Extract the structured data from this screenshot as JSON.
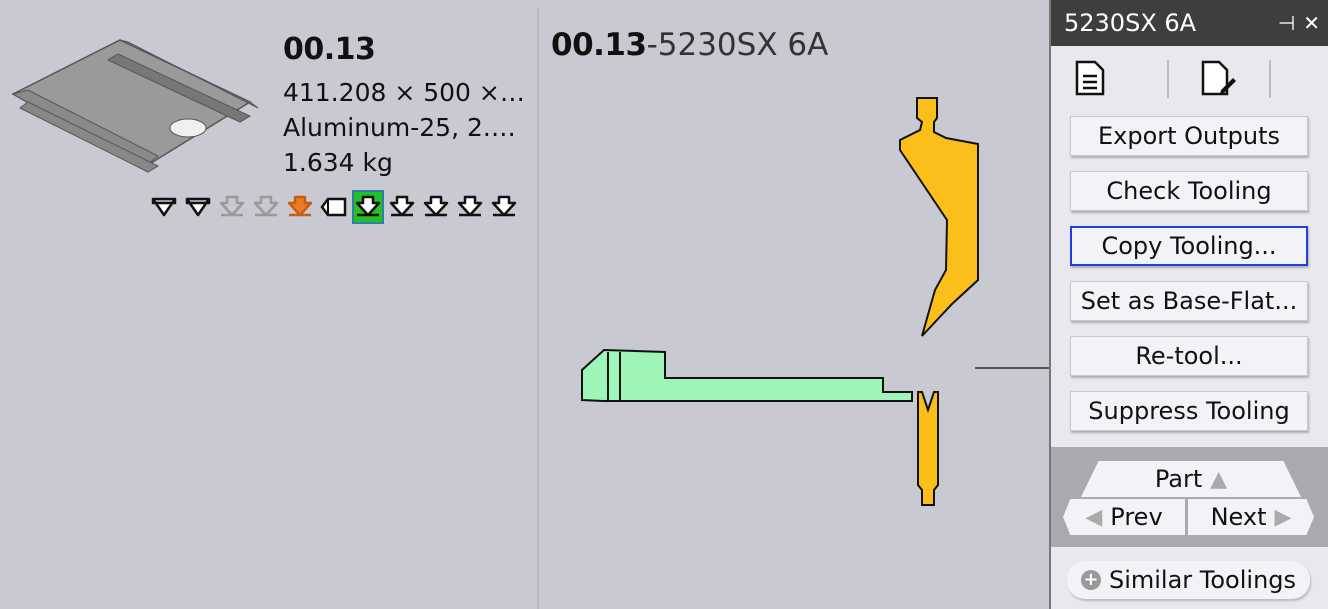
{
  "part": {
    "name": "00.13",
    "dims": "411.208 × 500 ×…",
    "material": "Aluminum-25, 2.…",
    "weight": "1.634 kg"
  },
  "bend_icons": [
    {
      "name": "bend-icon-1",
      "state": "normal"
    },
    {
      "name": "bend-icon-2",
      "state": "normal"
    },
    {
      "name": "bend-icon-3",
      "state": "disabled"
    },
    {
      "name": "bend-icon-4",
      "state": "disabled"
    },
    {
      "name": "bend-icon-5",
      "state": "orange"
    },
    {
      "name": "bend-icon-6",
      "state": "normal"
    },
    {
      "name": "bend-icon-7",
      "state": "selected"
    },
    {
      "name": "bend-icon-8",
      "state": "normal"
    },
    {
      "name": "bend-icon-9",
      "state": "normal"
    },
    {
      "name": "bend-icon-10",
      "state": "normal"
    },
    {
      "name": "bend-icon-11",
      "state": "normal"
    }
  ],
  "view": {
    "title_bold": "00.13",
    "title_rest": "-5230SX 6A"
  },
  "panel": {
    "title": "5230SX 6A",
    "pin_icon": "pin-icon",
    "close_icon": "close-icon",
    "buttons": [
      "Export Outputs",
      "Check Tooling",
      "Copy Tooling...",
      "Set as Base-Flat...",
      "Re-tool...",
      "Suppress Tooling"
    ],
    "nav": {
      "part": "Part",
      "prev": "Prev",
      "next": "Next"
    },
    "similar": "Similar Toolings"
  },
  "colors": {
    "punch": "#fbbf1c",
    "die_green": "#9ef5b8",
    "selected_bend": "#25c025",
    "focus_border": "#1f3fe0"
  }
}
